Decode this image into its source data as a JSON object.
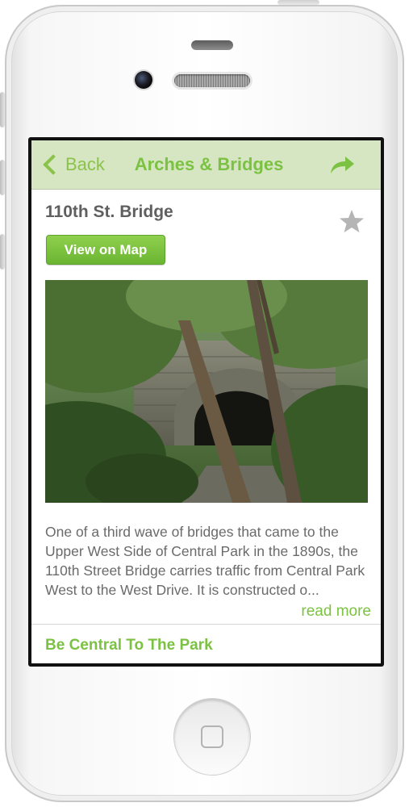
{
  "navbar": {
    "back_label": "Back",
    "title": "Arches & Bridges",
    "share_icon": "share-arrow-icon"
  },
  "item": {
    "title": "110th St. Bridge",
    "favorite_icon": "star-icon",
    "map_button_label": "View on Map",
    "description": "One of a third wave of bridges that came to the Upper West Side of Central Park in the 1890s, the 110th Street Bridge carries traffic from Central Park West to the West Drive. It is constructed o...",
    "read_more_label": "read more"
  },
  "footer": {
    "tagline": "Be Central To The Park"
  },
  "colors": {
    "accent_green": "#7cc242",
    "navbar_bg": "#d6e6c2",
    "button_green": "#6ab532",
    "text_gray": "#6a6a6a"
  }
}
